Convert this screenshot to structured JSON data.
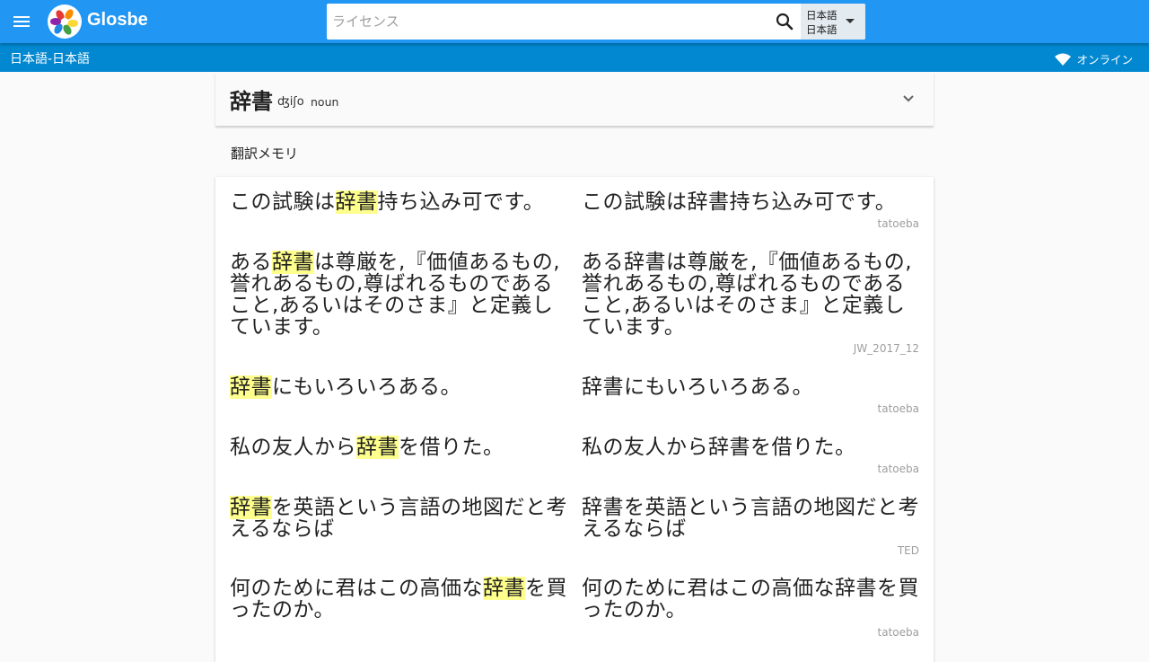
{
  "header": {
    "brand": "Glosbe",
    "search_placeholder": "ライセンス",
    "lang_from": "日本語",
    "lang_to": "日本語"
  },
  "subbar": {
    "pair": "日本語-日本語",
    "status": "オンライン"
  },
  "entry": {
    "word": "辞書",
    "pronunciation": "ʤiʃo",
    "pos": "noun"
  },
  "section_title": "翻訳メモリ",
  "memory": [
    {
      "src": [
        {
          "t": "この試験は"
        },
        {
          "t": "辞書",
          "h": true
        },
        {
          "t": "持ち込み可です。"
        }
      ],
      "tgt": "この試験は辞書持ち込み可です。",
      "source": "tatoeba"
    },
    {
      "src": [
        {
          "t": "ある"
        },
        {
          "t": "辞書",
          "h": true
        },
        {
          "t": "は尊厳を,『価値あるもの,誉れあるもの,尊ばれるものであること,あるいはそのさま』と定義しています。"
        }
      ],
      "tgt": "ある辞書は尊厳を,『価値あるもの,誉れあるもの,尊ばれるものであること,あるいはそのさま』と定義しています。",
      "source": "JW_2017_12"
    },
    {
      "src": [
        {
          "t": "辞書",
          "h": true
        },
        {
          "t": "にもいろいろある。"
        }
      ],
      "tgt": "辞書にもいろいろある。",
      "source": "tatoeba"
    },
    {
      "src": [
        {
          "t": "私の友人から"
        },
        {
          "t": "辞書",
          "h": true
        },
        {
          "t": "を借りた。"
        }
      ],
      "tgt": "私の友人から辞書を借りた。",
      "source": "tatoeba"
    },
    {
      "src": [
        {
          "t": "辞書",
          "h": true
        },
        {
          "t": "を英語という言語の地図だと考えるならば"
        }
      ],
      "tgt": "辞書を英語という言語の地図だと考えるならば",
      "source": "TED"
    },
    {
      "src": [
        {
          "t": "何のために君はこの高価な"
        },
        {
          "t": "辞書",
          "h": true
        },
        {
          "t": "を買ったのか。"
        }
      ],
      "tgt": "何のために君はこの高価な辞書を買ったのか。",
      "source": "tatoeba"
    }
  ]
}
